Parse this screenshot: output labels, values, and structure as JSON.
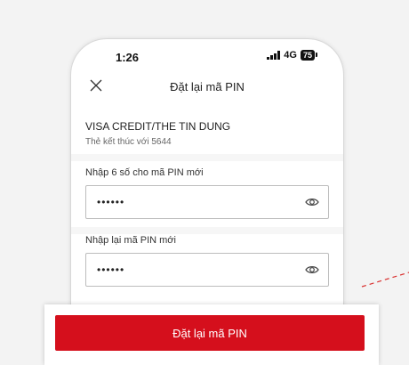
{
  "status_bar": {
    "time": "1:26",
    "network": "4G",
    "battery": "75"
  },
  "header": {
    "title": "Đặt lại mã PIN",
    "close_icon": "close-icon"
  },
  "card": {
    "name": "VISA CREDIT/THE TIN DUNG",
    "ending_text": "Thẻ kết thúc với 5644"
  },
  "fields": [
    {
      "label": "Nhập 6 số cho mã PIN mới",
      "value": "••••••",
      "icon": "eye-icon"
    },
    {
      "label": "Nhập lại mã PIN mới",
      "value": "••••••",
      "icon": "eye-icon"
    }
  ],
  "footer": {
    "submit_label": "Đặt lại mã PIN"
  },
  "colors": {
    "primary": "#d50f1c",
    "annotation": "#d9302f"
  }
}
